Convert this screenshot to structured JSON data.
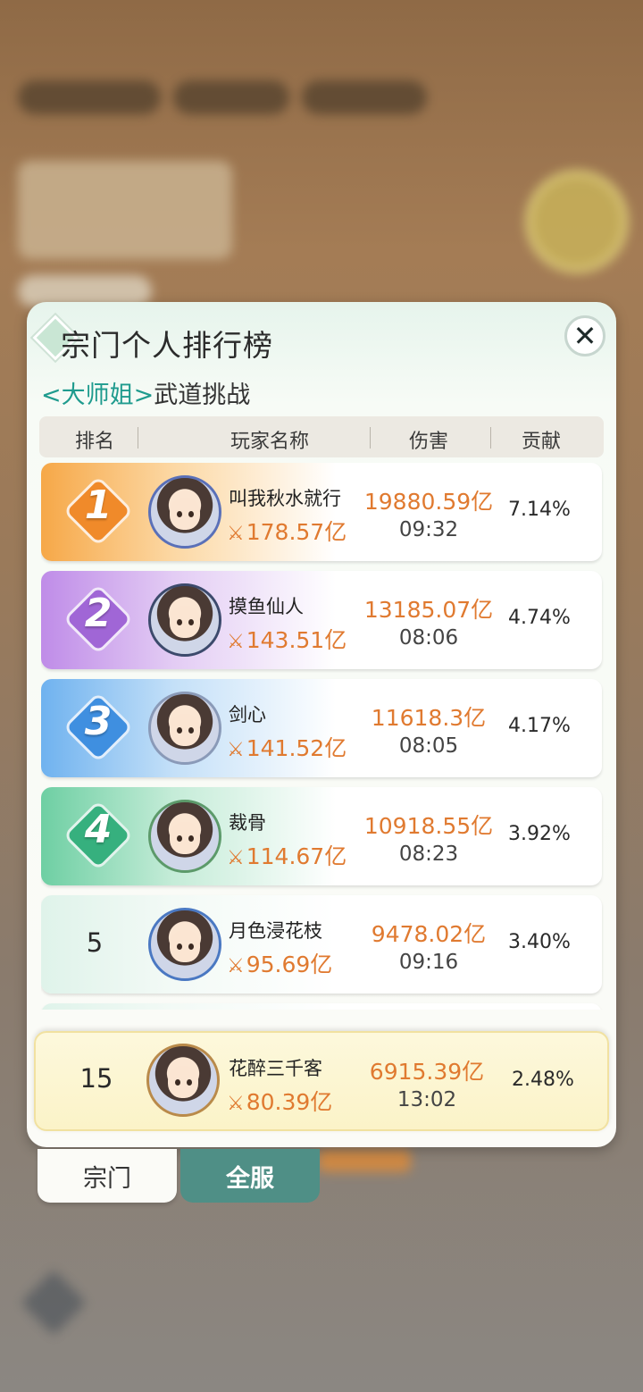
{
  "panel": {
    "title": "宗门个人排行榜",
    "subtitle_boss": "<大师姐>",
    "subtitle_mode": "武道挑战",
    "close_label": "✕"
  },
  "table": {
    "headers": [
      "排名",
      "玩家名称",
      "伤害",
      "贡献"
    ],
    "rows": [
      {
        "rank": "1",
        "name": "叫我秋水就行",
        "power": "178.57亿",
        "damage": "19880.59亿",
        "time": "09:32",
        "contribution": "7.14%"
      },
      {
        "rank": "2",
        "name": "摸鱼仙人",
        "power": "143.51亿",
        "damage": "13185.07亿",
        "time": "08:06",
        "contribution": "4.74%"
      },
      {
        "rank": "3",
        "name": "剑心",
        "power": "141.52亿",
        "damage": "11618.3亿",
        "time": "08:05",
        "contribution": "4.17%"
      },
      {
        "rank": "4",
        "name": "裁骨",
        "power": "114.67亿",
        "damage": "10918.55亿",
        "time": "08:23",
        "contribution": "3.92%"
      },
      {
        "rank": "5",
        "name": "月色浸花枝",
        "power": "95.69亿",
        "damage": "9478.02亿",
        "time": "09:16",
        "contribution": "3.40%"
      }
    ]
  },
  "self_row": {
    "rank": "15",
    "name": "花醉三千客",
    "power": "80.39亿",
    "damage": "6915.39亿",
    "time": "13:02",
    "contribution": "2.48%"
  },
  "tabs": {
    "sect": "宗门",
    "all_server": "全服"
  },
  "icons": {
    "power": "crossed-swords-icon",
    "close": "close-icon"
  },
  "colors": {
    "accent_orange": "#e07a30",
    "boss_teal": "#1f9b8e",
    "tab_active": "#4f8f86"
  }
}
